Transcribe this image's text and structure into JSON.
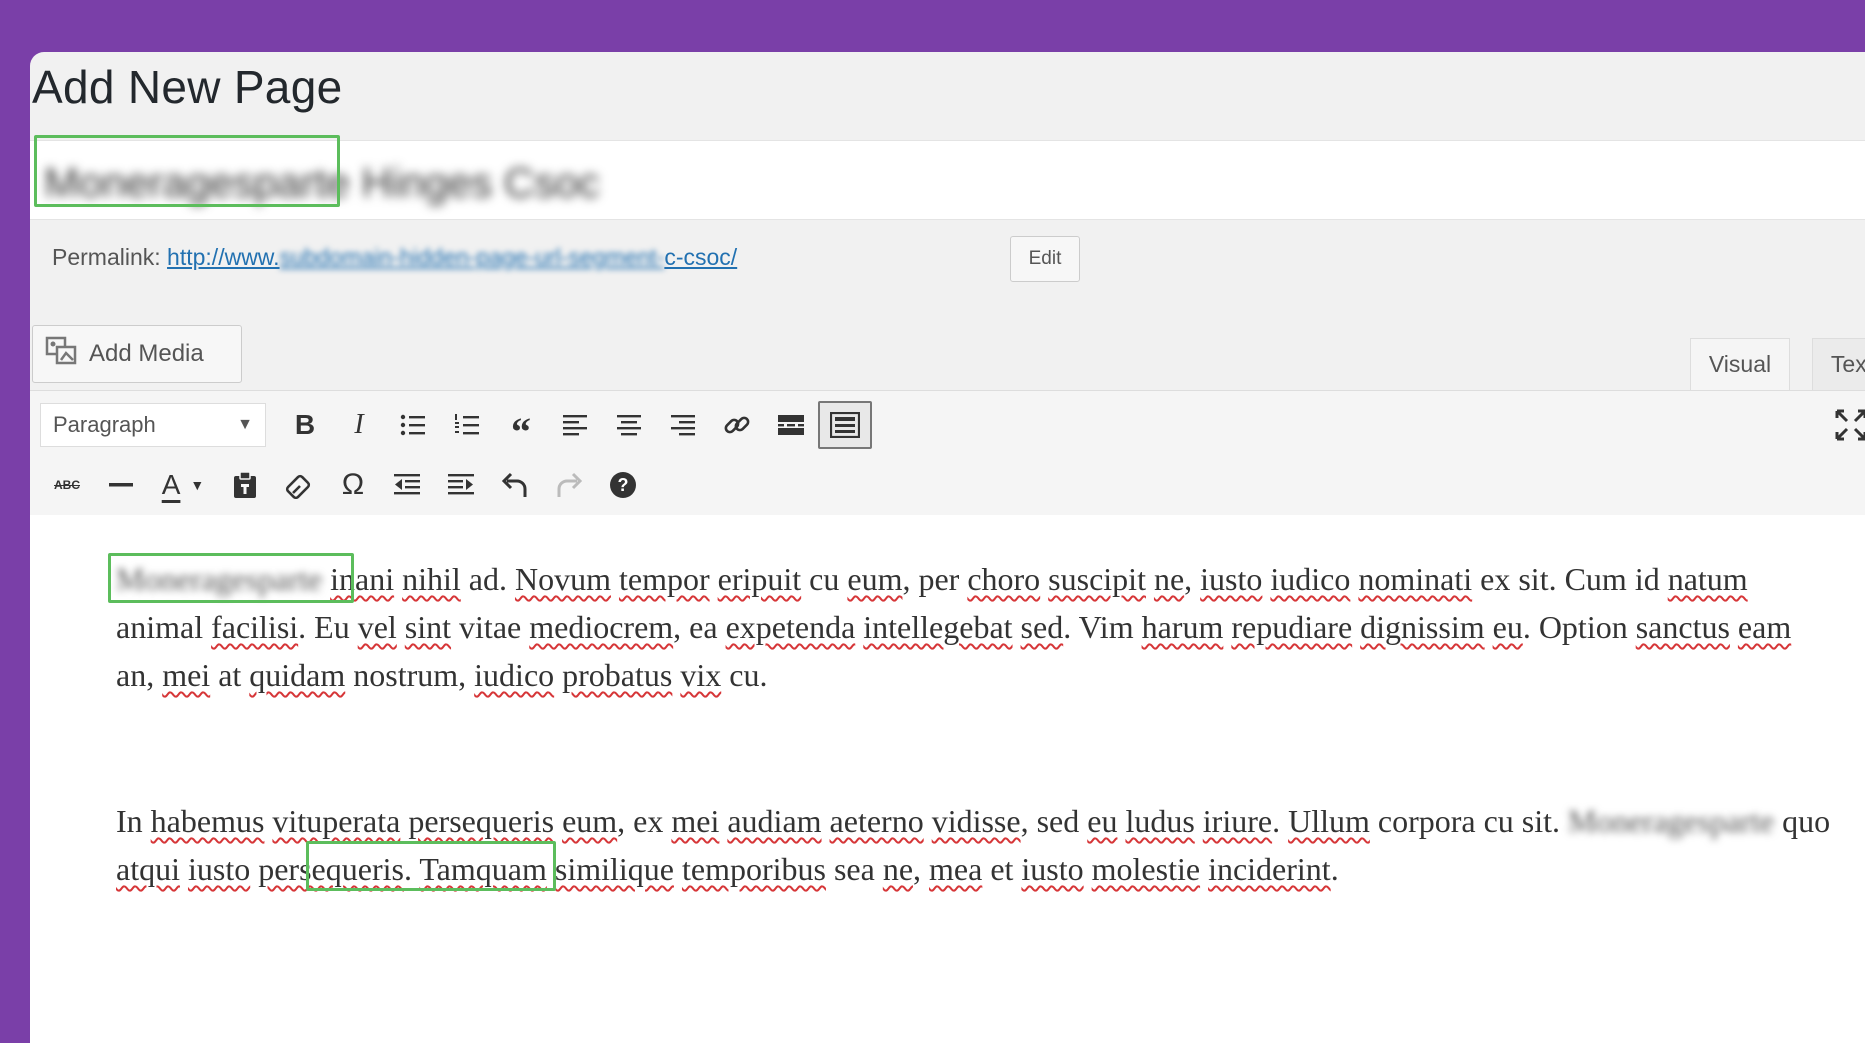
{
  "page": {
    "title": "Add New Page"
  },
  "title_field": {
    "value": "Moneragesparte Hinges Csoc"
  },
  "permalink": {
    "label": "Permalink:",
    "url_start": "http://www.",
    "url_middle": "subdomain-hidden-page-url-segment-",
    "url_end": "c-csoc/",
    "edit_label": "Edit"
  },
  "media": {
    "add_media_label": "Add Media"
  },
  "editor_tabs": {
    "visual": "Visual",
    "text": "Text"
  },
  "toolbar": {
    "format_value": "Paragraph",
    "row1": [
      "bold",
      "italic",
      "bulleted-list",
      "numbered-list",
      "blockquote",
      "align-left",
      "align-center",
      "align-right",
      "insert-link",
      "read-more",
      "toolbar-toggle"
    ],
    "row2": [
      "strikethrough",
      "horizontal-line",
      "text-color",
      "paste-as-text",
      "clear-formatting",
      "special-character",
      "decrease-indent",
      "increase-indent",
      "undo",
      "redo",
      "help"
    ]
  },
  "content": {
    "p1_keyword": "Moneragesparte",
    "p1_w1": "inani",
    "p1_w2": "nihil",
    "p1_t1": "ad.",
    "p1_w3": "Novum",
    "p1_w4": "tempor",
    "p1_w5": "eripuit",
    "p1_t2": "cu",
    "p1_w6": "eum",
    "p1_t3": ", per",
    "p1_w7": "choro",
    "p1_w8": "suscipit",
    "p1_w9": "ne",
    "p1_t4": ",",
    "p1_w10": "iusto",
    "p1_w11": "iudico",
    "p1_w12": "nominati",
    "p1_t5": "ex sit. Cum id",
    "p1_w13": "natum",
    "p1_t6": "animal",
    "p1_w14": "facilisi",
    "p1_t7": ". Eu",
    "p1_w15": "vel",
    "p1_w16": "sint",
    "p1_t8": "vitae",
    "p1_w17": "mediocrem",
    "p1_t9": ", ea",
    "p1_w18": "expetenda",
    "p1_w19": "intellegebat",
    "p1_w20": "sed",
    "p1_t10": ". Vim",
    "p1_w21": "harum",
    "p1_w22": "repudiare",
    "p1_w23": "dignissim",
    "p1_w24": "eu",
    "p1_t11": ". Option",
    "p1_w25": "sanctus",
    "p1_w26": "eam",
    "p1_t12": "an,",
    "p1_w27": "mei",
    "p1_t13": "at",
    "p1_w28": "quidam",
    "p1_t14": "nostrum,",
    "p1_w29": "iudico",
    "p1_w30": "probatus",
    "p1_w31": "vix",
    "p1_t15": "cu.",
    "p2_t1": "In",
    "p2_w1": "habemus",
    "p2_w2": "vituperata",
    "p2_w3": "persequeris",
    "p2_w4": "eum",
    "p2_t2": ", ex",
    "p2_w5": "mei",
    "p2_w6": "audiam",
    "p2_w7": "aeterno",
    "p2_w8": "vidisse",
    "p2_t3": ", sed",
    "p2_w9": "eu",
    "p2_w10": "ludus",
    "p2_w11": "iriure",
    "p2_t4": ".",
    "p2_w12": "Ullum",
    "p2_t5": "corpora cu sit.",
    "p2_keyword": "Moneragesparte",
    "p2_t6": "quo",
    "p2_w13": "atqui",
    "p2_w14": "iusto",
    "p2_w15": "persequeris",
    "p2_t7": ".",
    "p2_w16": "Tamquam",
    "p2_w17": "similique",
    "p2_w18": "temporibus",
    "p2_t8": "sea",
    "p2_w19": "ne",
    "p2_t9": ",",
    "p2_w20": "mea",
    "p2_t10": "et",
    "p2_w21": "iusto",
    "p2_w22": "molestie",
    "p2_w23": "inciderint",
    "p2_t11": "."
  },
  "colors": {
    "frame": "#7a3fa8",
    "highlight": "#5cbd5c",
    "link": "#2271b1",
    "spellcheck": "#d63638"
  }
}
